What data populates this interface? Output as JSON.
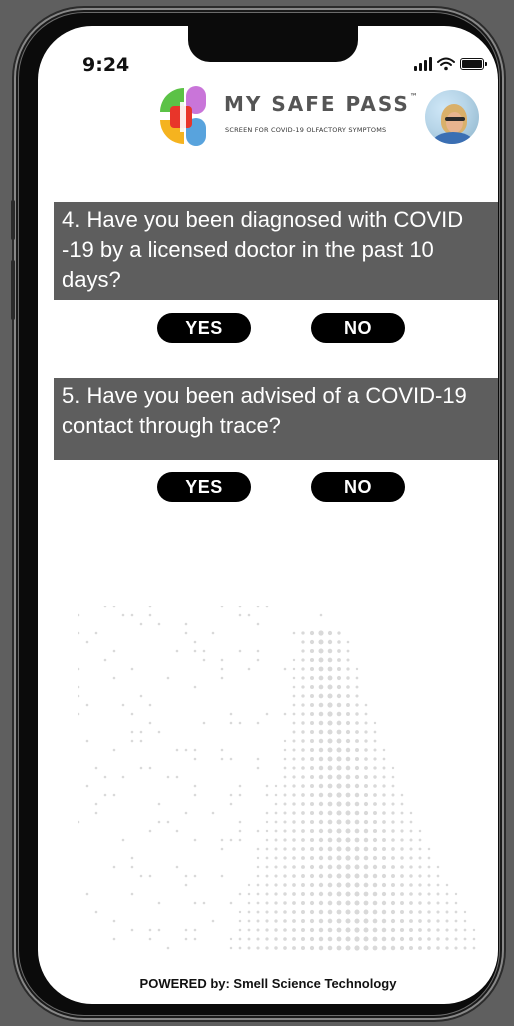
{
  "status_bar": {
    "time": "9:24"
  },
  "header": {
    "title": "MY SAFE PASS",
    "trademark": "™",
    "subtitle": "SCREEN FOR COVID-19 OLFACTORY SYMPTOMS"
  },
  "questions": [
    {
      "text": "4. Have you been diagnosed with COVID -19 by a licensed doctor in the past 10 days?",
      "yes_label": "YES",
      "no_label": "NO"
    },
    {
      "text": "5. Have you been advised of a COVID-19 contact through trace?",
      "yes_label": "YES",
      "no_label": "NO"
    }
  ],
  "footer": {
    "text": "POWERED by: Smell Science Technology"
  },
  "colors": {
    "question_bg": "#5e5e5e",
    "button_bg": "#000000",
    "logo_red": "#e8352a",
    "logo_pink": "#c975d9",
    "logo_green": "#5bc246",
    "logo_yellow": "#f5b31f",
    "logo_blue": "#58a3dd"
  }
}
